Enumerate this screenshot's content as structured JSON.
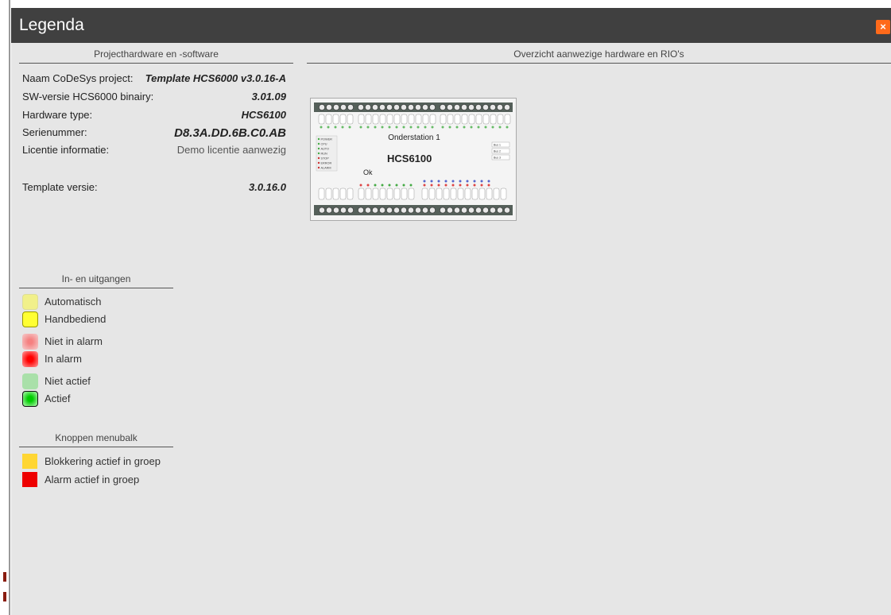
{
  "dialog": {
    "title": "Legenda",
    "close_label": "×"
  },
  "project": {
    "heading": "Projecthardware en -software",
    "rows": [
      {
        "label": "Naam CoDeSys project:",
        "value": "Template HCS6000 v3.0.16-A"
      },
      {
        "label": "SW-versie HCS6000 binairy:",
        "value": "3.01.09"
      },
      {
        "label": "Hardware type:",
        "value": "HCS6100"
      },
      {
        "label": "Serienummer:",
        "value": "D8.3A.DD.6B.C0.AB"
      },
      {
        "label": "Licentie informatie:",
        "value": "Demo licentie aanwezig"
      }
    ],
    "template_label": "Template versie:",
    "template_value": "3.0.16.0"
  },
  "hardware": {
    "heading": "Overzicht aanwezige hardware en RIO's",
    "module_title": "Onderstation 1",
    "module_logo": "HCS6100",
    "module_status": "Ok",
    "leds": [
      "POWER",
      "CPU",
      "AUTO",
      "RUN",
      "STOP",
      "ERROR",
      "ALARM"
    ],
    "module_tabs": [
      "Bus 1",
      "Bus 2",
      "Bus 3"
    ]
  },
  "io_legend": {
    "heading": "In- en uitgangen",
    "items": [
      {
        "label": "Automatisch",
        "color": "#f1f08a"
      },
      {
        "label": "Handbediend",
        "color": "#ffff33"
      },
      {
        "label": "Niet in alarm",
        "color": "#f3a7a7"
      },
      {
        "label": "In alarm",
        "color": "#ff3333"
      },
      {
        "label": "Niet actief",
        "color": "#a9e0a9"
      },
      {
        "label": "Actief",
        "color": "#33dd33"
      }
    ]
  },
  "buttons_legend": {
    "heading": "Knoppen menubalk",
    "items": [
      {
        "label": "Blokkering actief in groep",
        "color": "#ffd633"
      },
      {
        "label": "Alarm actief in groep",
        "color": "#ee0000"
      }
    ]
  }
}
